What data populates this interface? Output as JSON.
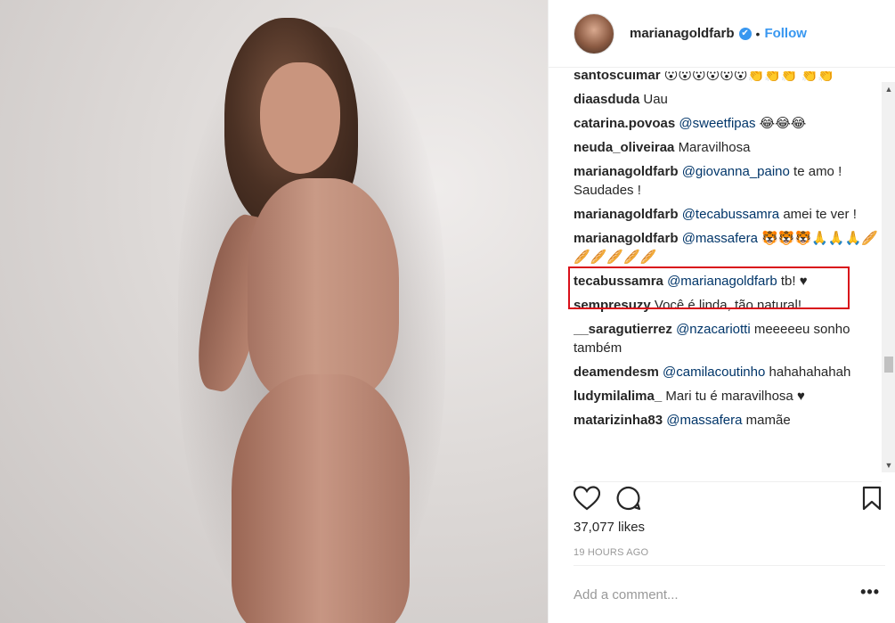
{
  "post": {
    "username": "marianagoldfarb",
    "follow_label": "Follow",
    "separator": "•",
    "verified_glyph": "✔"
  },
  "comments": [
    {
      "user": "santoscuimar",
      "mention": "",
      "text": "😮😮😮😮😮😮👏👏👏 👏👏"
    },
    {
      "user": "diaasduda",
      "mention": "",
      "text": "Uau"
    },
    {
      "user": "catarina.povoas",
      "mention": "@sweetfipas",
      "text": "😂😂😂"
    },
    {
      "user": "neuda_oliveiraa",
      "mention": "",
      "text": "Maravilhosa"
    },
    {
      "user": "marianagoldfarb",
      "mention": "@giovanna_paino",
      "text": "te amo ! Saudades !"
    },
    {
      "user": "marianagoldfarb",
      "mention": "@tecabussamra",
      "text": "amei te ver !"
    },
    {
      "user": "marianagoldfarb",
      "mention": "@massafera",
      "text": "🐯🐯🐯🙏🙏🙏🥖🥖🥖🥖🥖🥖"
    },
    {
      "user": "tecabussamra",
      "mention": "@marianagoldfarb",
      "text": "tb! ♥"
    },
    {
      "user": "sempresuzy",
      "mention": "",
      "text": "Você é linda, tão natural!"
    },
    {
      "user": "__saragutierrez",
      "mention": "@nzacariotti",
      "text": "meeeeeu sonho também"
    },
    {
      "user": "deamendesm",
      "mention": "@camilacoutinho",
      "text": "hahahahahah"
    },
    {
      "user": "ludymilalima_",
      "mention": "",
      "text": "Mari tu é maravilhosa ♥"
    },
    {
      "user": "matarizinha83",
      "mention": "@massafera",
      "text": "mamãe"
    }
  ],
  "actions": {
    "likes": "37,077 likes",
    "time": "19 HOURS AGO",
    "comment_placeholder": "Add a comment...",
    "more_glyph": "•••"
  },
  "scroll": {
    "up": "▲",
    "down": "▼"
  },
  "icons": {
    "like": "heart-icon",
    "comment": "comment-icon",
    "save": "bookmark-icon"
  },
  "colors": {
    "accent": "#3897f0",
    "mention": "#003569",
    "highlight": "#d9101a"
  }
}
